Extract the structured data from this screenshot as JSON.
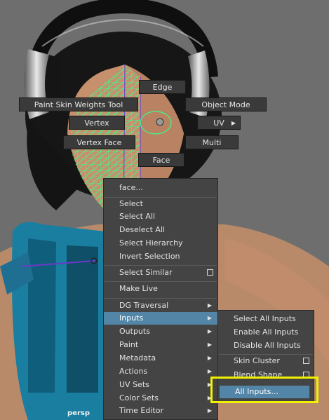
{
  "marking_menu": {
    "edge": "Edge",
    "paint_skin_weights": "Paint Skin Weights Tool",
    "object_mode": "Object Mode",
    "vertex": "Vertex",
    "uv": "UV",
    "vertex_face": "Vertex Face",
    "multi": "Multi",
    "face": "Face"
  },
  "context_menu": {
    "header": "face...",
    "items": [
      {
        "label": "Select"
      },
      {
        "label": "Select All"
      },
      {
        "label": "Deselect All"
      },
      {
        "label": "Select Hierarchy"
      },
      {
        "label": "Invert Selection"
      },
      {
        "label": "Select Similar"
      },
      {
        "label": "Make Live"
      },
      {
        "label": "DG Traversal"
      },
      {
        "label": "Inputs"
      },
      {
        "label": "Outputs"
      },
      {
        "label": "Paint"
      },
      {
        "label": "Metadata"
      },
      {
        "label": "Actions"
      },
      {
        "label": "UV Sets"
      },
      {
        "label": "Color Sets"
      },
      {
        "label": "Time Editor"
      }
    ]
  },
  "inputs_submenu": {
    "items": [
      {
        "label": "Select All Inputs"
      },
      {
        "label": "Enable All Inputs"
      },
      {
        "label": "Disable All Inputs"
      },
      {
        "label": "Skin Cluster"
      },
      {
        "label": "Blend Shape"
      },
      {
        "label": "All Inputs..."
      }
    ]
  },
  "viewport": {
    "camera_label": "persp"
  },
  "colors": {
    "highlight": "#5285a6",
    "wireframe": "#34ff8c",
    "callout": "#f0f000"
  }
}
